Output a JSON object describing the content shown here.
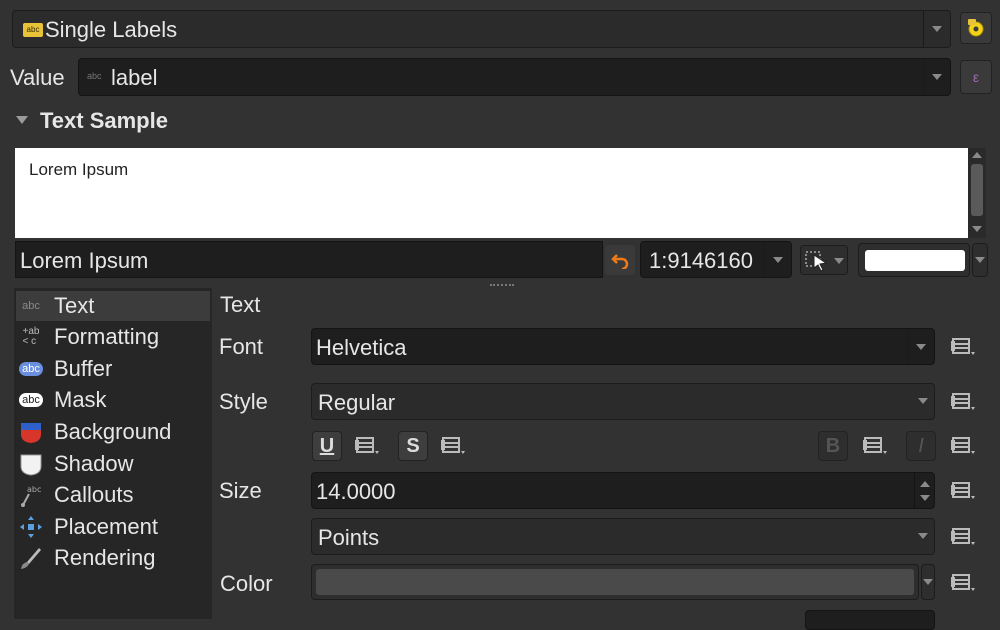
{
  "renderer": {
    "selected": "Single Labels",
    "icon": "abc-label-icon"
  },
  "value": {
    "label": "Value",
    "field": "label",
    "field_icon": "abc-field-icon"
  },
  "text_sample": {
    "heading": "Text Sample",
    "preview_text": "Lorem Ipsum",
    "input_value": "Lorem Ipsum",
    "scale": "1:9146160"
  },
  "sidebar": {
    "items": [
      {
        "label": "Text",
        "icon": "abc-text-icon"
      },
      {
        "label": "Formatting",
        "icon": "formatting-icon"
      },
      {
        "label": "Buffer",
        "icon": "buffer-icon"
      },
      {
        "label": "Mask",
        "icon": "mask-icon"
      },
      {
        "label": "Background",
        "icon": "background-shield-icon"
      },
      {
        "label": "Shadow",
        "icon": "shadow-shield-icon"
      },
      {
        "label": "Callouts",
        "icon": "callouts-icon"
      },
      {
        "label": "Placement",
        "icon": "placement-icon"
      },
      {
        "label": "Rendering",
        "icon": "rendering-brush-icon"
      }
    ]
  },
  "text_panel": {
    "title": "Text",
    "font_label": "Font",
    "font_value": "Helvetica",
    "style_label": "Style",
    "style_value": "Regular",
    "underline": "U",
    "strike": "S",
    "bold": "B",
    "italic": "I",
    "size_label": "Size",
    "size_value": "14.0000",
    "unit_value": "Points",
    "color_label": "Color",
    "color_value": "#4a4a4a"
  },
  "colors": {
    "background": "#323232",
    "accent_orange": "#f07a1a",
    "preview_bg": "#ffffff"
  }
}
